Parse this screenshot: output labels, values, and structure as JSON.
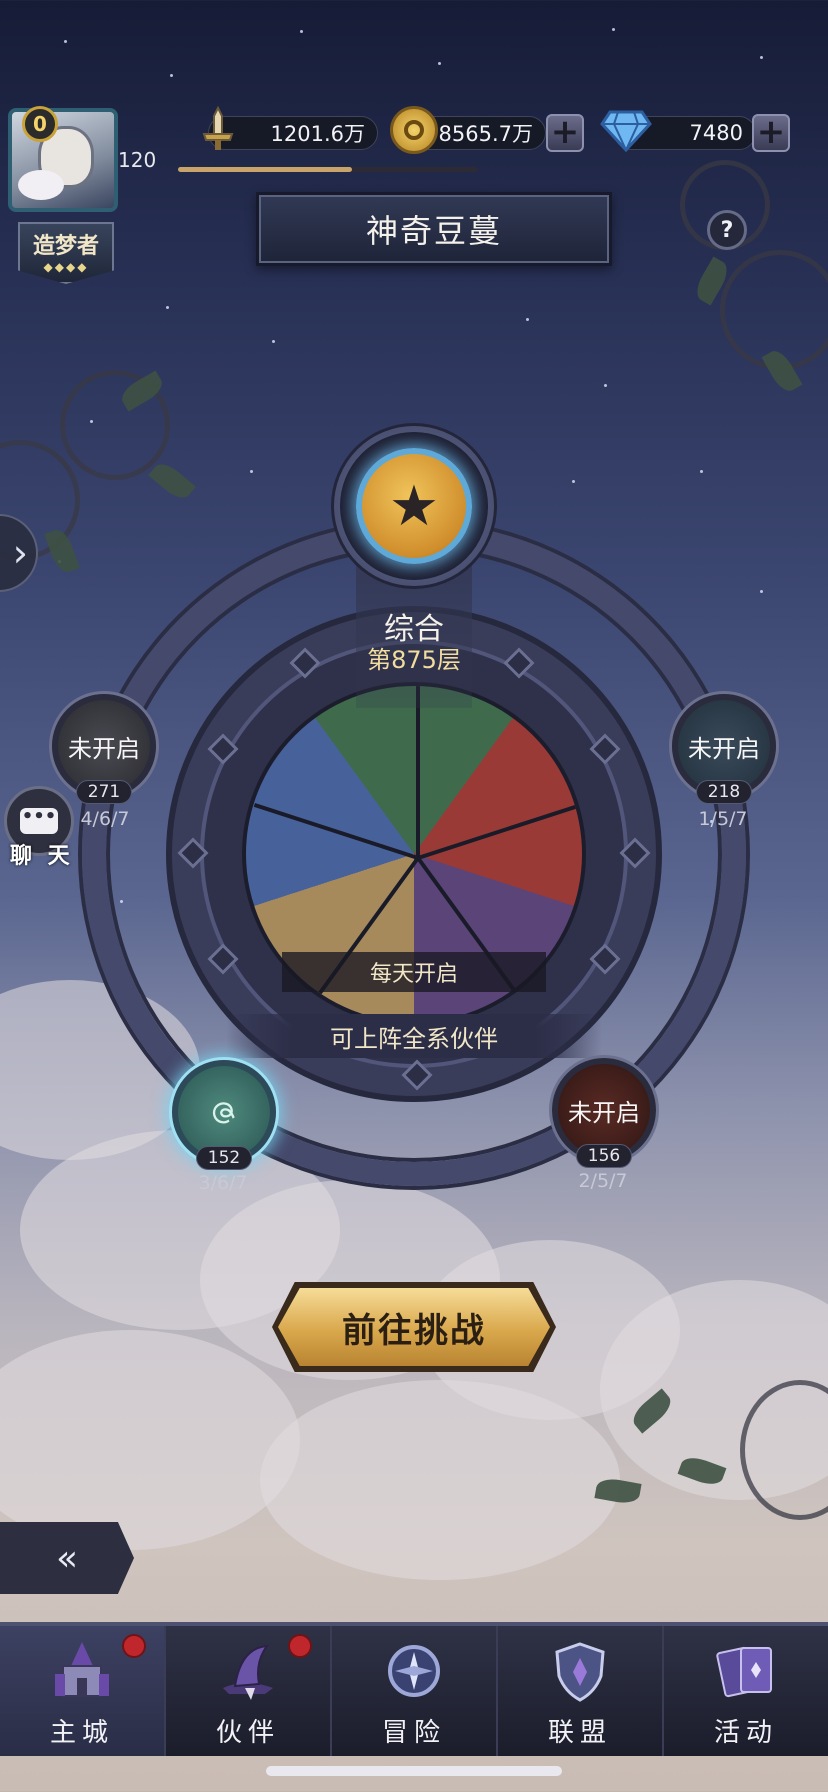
{
  "profile": {
    "vip_level": "0",
    "level": "120",
    "exp_fraction": 0.58,
    "rank_title": "造梦者",
    "rank_stars": "◆◆◆◆"
  },
  "resources": {
    "power": "1201.6万",
    "gold": "8565.7万",
    "diamonds": "7480"
  },
  "page": {
    "title": "神奇豆蔓",
    "help": "?"
  },
  "center_mode": {
    "name": "综合",
    "floor": "第875层",
    "daily_label": "每天开启",
    "all_partners_label": "可上阵全系伙伴"
  },
  "nodes": {
    "top_left": {
      "status": "未开启",
      "count": "271",
      "progress": "4/6/7"
    },
    "top_right": {
      "status": "未开启",
      "count": "218",
      "progress": "1/5/7"
    },
    "bottom_left": {
      "status": "",
      "count": "152",
      "progress": "3/6/7"
    },
    "bottom_right": {
      "status": "未开启",
      "count": "156",
      "progress": "2/5/7"
    }
  },
  "chat": {
    "label": "聊 天",
    "icon": "•••"
  },
  "challenge": {
    "label": "前往挑战"
  },
  "nav": {
    "items": [
      {
        "label": "主城",
        "icon": "castle-icon",
        "badge": true,
        "active": true
      },
      {
        "label": "伙伴",
        "icon": "hat-icon",
        "badge": true,
        "active": false
      },
      {
        "label": "冒险",
        "icon": "compass-icon",
        "badge": false,
        "active": false
      },
      {
        "label": "联盟",
        "icon": "shield-icon",
        "badge": false,
        "active": false
      },
      {
        "label": "活动",
        "icon": "cards-icon",
        "badge": false,
        "active": false
      }
    ]
  },
  "colors": {
    "accent_gold": "#d9a84c",
    "medal_glow": "#5fa9d8",
    "badge_red": "#c0272d"
  }
}
